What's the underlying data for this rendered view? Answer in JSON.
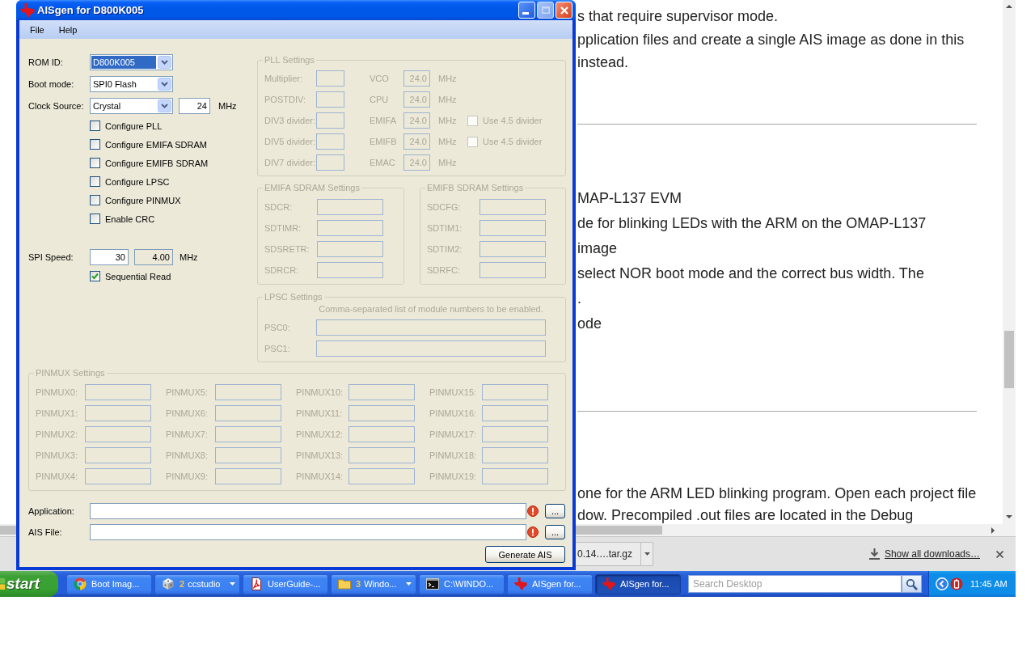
{
  "browser": {
    "sections": [
      {
        "lines": [
          "s that require supervisor mode.",
          "pplication files and create a single AIS image as done in this",
          "instead."
        ]
      },
      {
        "lines": [
          "MAP-L137 EVM",
          "de for blinking LEDs with the ARM on the OMAP-L137",
          "image",
          "select NOR boot mode and the correct bus width. The",
          ".",
          "ode"
        ]
      },
      {
        "lines": [
          "one for the ARM LED blinking program. Open each project file",
          "dow. Precompiled .out files are located in the Debug"
        ]
      }
    ],
    "downloads": [
      {
        "name": "0.14….tar.gz"
      }
    ],
    "show_all_downloads": "Show all downloads…"
  },
  "taskbar": {
    "start": "start",
    "items": [
      {
        "kind": "browser",
        "label": "Boot Imag...",
        "grouped": false,
        "selected": false
      },
      {
        "kind": "ide",
        "count": "2",
        "label": "ccstudio",
        "grouped": true,
        "selected": false
      },
      {
        "kind": "pdf",
        "label": "UserGuide-...",
        "grouped": false,
        "selected": false
      },
      {
        "kind": "folder",
        "count": "3",
        "label": "Windo...",
        "grouped": true,
        "selected": false
      },
      {
        "kind": "console",
        "label": "C:\\WINDO...",
        "grouped": false,
        "selected": false
      },
      {
        "kind": "app",
        "label": "AISgen for...",
        "grouped": false,
        "selected": false
      },
      {
        "kind": "app",
        "label": "AISgen for...",
        "grouped": false,
        "selected": true
      }
    ],
    "search": {
      "placeholder": "Search Desktop"
    },
    "tray": {
      "time": "11:45 AM"
    }
  },
  "dialog": {
    "title": "AISgen for D800K005",
    "window_buttons": [
      {
        "kind": "minimize",
        "disabled": false
      },
      {
        "kind": "maximize",
        "disabled": true
      },
      {
        "kind": "close",
        "disabled": false
      }
    ],
    "menu": [
      "File",
      "Help"
    ],
    "selectors": [
      {
        "label": "ROM ID:",
        "value": "D800K005",
        "focused": true
      },
      {
        "label": "Boot mode:",
        "value": "SPI0 Flash",
        "focused": false
      },
      {
        "label": "Clock Source:",
        "value": "Crystal",
        "focused": false,
        "frequency": "24",
        "unit": "MHz"
      }
    ],
    "options": [
      {
        "label": "Configure PLL",
        "checked": false
      },
      {
        "label": "Configure EMIFA SDRAM",
        "checked": false
      },
      {
        "label": "Configure EMIFB SDRAM",
        "checked": false
      },
      {
        "label": "Configure LPSC",
        "checked": false
      },
      {
        "label": "Configure PINMUX",
        "checked": false
      },
      {
        "label": "Enable CRC",
        "checked": false
      }
    ],
    "spi_speed": {
      "label": "SPI Speed:",
      "inputs": [
        {
          "value": "30",
          "readonly": false
        },
        {
          "value": "4.00",
          "readonly": true
        }
      ],
      "unit": "MHz"
    },
    "sequential_read": {
      "label": "Sequential Read",
      "checked": true
    },
    "pll": {
      "title": "PLL Settings",
      "disabled": true,
      "rows": [
        {
          "label": "Multiplier:",
          "value_label": "VCO",
          "value": "24.0",
          "unit": "MHz"
        },
        {
          "label": "POSTDIV:",
          "value_label": "CPU",
          "value": "24.0",
          "unit": "MHz"
        },
        {
          "label": "DIV3 divider:",
          "value_label": "EMIFA",
          "value": "24.0",
          "unit": "MHz",
          "option": {
            "label": "Use 4.5 divider",
            "checked": false
          }
        },
        {
          "label": "DIV5 divider:",
          "value_label": "EMIFB",
          "value": "24.0",
          "unit": "MHz",
          "option": {
            "label": "Use 4.5 divider",
            "checked": false
          }
        },
        {
          "label": "DIV7 divider:",
          "value_label": "EMAC",
          "value": "24.0",
          "unit": "MHz"
        }
      ]
    },
    "emif_groups": [
      {
        "title": "EMIFA SDRAM Settings",
        "disabled": true,
        "fields": [
          "SDCR:",
          "SDTIMR:",
          "SDSRETR:",
          "SDRCR:"
        ]
      },
      {
        "title": "EMIFB SDRAM Settings",
        "disabled": true,
        "fields": [
          "SDCFG:",
          "SDTIM1:",
          "SDTIM2:",
          "SDRFC:"
        ]
      }
    ],
    "lpsc": {
      "title": "LPSC Settings",
      "disabled": true,
      "hint": "Comma-separated list of module numbers to be enabled.",
      "fields": [
        "PSC0:",
        "PSC1:"
      ]
    },
    "pinmux": {
      "title": "PINMUX Settings",
      "disabled": true,
      "fields": [
        "PINMUX0:",
        "PINMUX1:",
        "PINMUX2:",
        "PINMUX3:",
        "PINMUX4:",
        "PINMUX5:",
        "PINMUX6:",
        "PINMUX7:",
        "PINMUX8:",
        "PINMUX9:",
        "PINMUX10:",
        "PINMUX11:",
        "PINMUX12:",
        "PINMUX13:",
        "PINMUX14:",
        "PINMUX15:",
        "PINMUX16:",
        "PINMUX17:",
        "PINMUX18:",
        "PINMUX19:"
      ]
    },
    "files": [
      {
        "label": "Application:",
        "error": true,
        "browse": "..."
      },
      {
        "label": "AIS File:",
        "error": true,
        "browse": "..."
      }
    ],
    "generate_button": "Generate AIS"
  }
}
